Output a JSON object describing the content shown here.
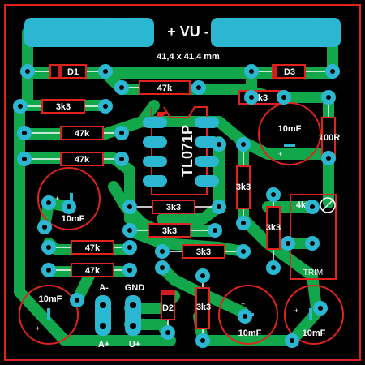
{
  "board": {
    "header": "+ VU -",
    "dimensions": "41,4 x 41,4 mm",
    "colors": {
      "background": "#000000",
      "trace": "#11a74a",
      "pad": "#2bb7d2",
      "silk": "#ffffff",
      "outline": "#e0241c",
      "body": "#d31d1d"
    }
  },
  "components": {
    "diodes": {
      "d1": "D1",
      "d2": "D2",
      "d3": "D3"
    },
    "resistors": {
      "r_top": "47k",
      "r_top_right": "3k3",
      "r_left1": "3k3",
      "r_left2": "47k",
      "r_left3": "47k",
      "r_mid1": "3k3",
      "r_mid2": "3k3",
      "r_mid3": "3k3",
      "r_left4": "47k",
      "r_left5": "47k",
      "r_vert1": "3k3",
      "r_vert2": "3k3",
      "r_bottom": "3k3",
      "r_right": "100R"
    },
    "capacitors": {
      "c_top_right": "10mF",
      "c_left": "10mF",
      "c_bottom_left": "10mF",
      "c_bottom_mid": "10mF",
      "c_bottom_right": "10mF"
    },
    "ic": "TL071P",
    "trimmer": {
      "value": "4k7",
      "label": "TRIM"
    },
    "connectors": {
      "a_minus": "A-",
      "gnd": "GND",
      "a_plus": "A+",
      "u_plus": "U+"
    }
  }
}
